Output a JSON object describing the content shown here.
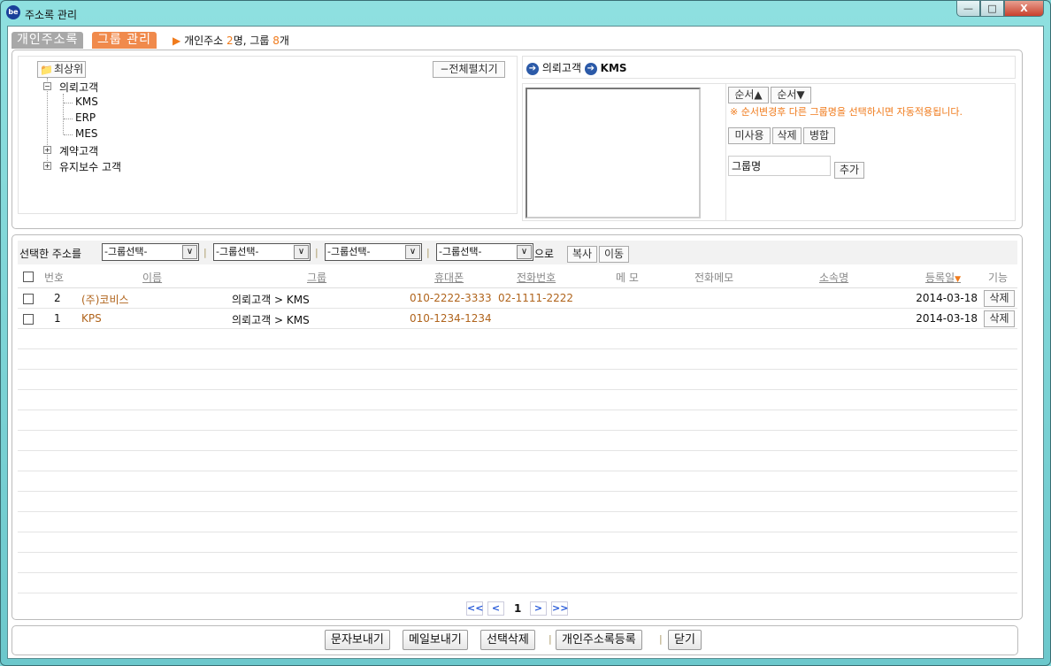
{
  "window": {
    "title": "주소록 관리",
    "min": "—",
    "max": "□",
    "close": "X"
  },
  "tabs": [
    {
      "label": "개인주소록",
      "active": false
    },
    {
      "label": "그룹 관리",
      "active": true
    }
  ],
  "summary": {
    "prefix": "개인주소 ",
    "people": "2",
    "people_unit": "명, 그룹 ",
    "groups": "8",
    "groups_unit": "개"
  },
  "tree": {
    "root_button": "최상위",
    "expand_all": "−전체펼치기",
    "nodes": [
      {
        "label": "의뢰고객",
        "expanded": true,
        "children": [
          "KMS",
          "ERP",
          "MES"
        ]
      },
      {
        "label": "계약고객",
        "expanded": false
      },
      {
        "label": "유지보수 고객",
        "expanded": false
      }
    ]
  },
  "breadcrumb": [
    "의뢰고객",
    "KMS"
  ],
  "group_panel": {
    "order_up": "순서▲",
    "order_down": "순서▼",
    "notice": "※ 순서변경후 다른 그룹명을 선택하시면 자동적용됩니다.",
    "unused": "미사용",
    "delete": "삭제",
    "merge": "병합",
    "group_name_value": "그룹명",
    "add": "추가"
  },
  "toolbar": {
    "label": "선택한 주소를",
    "selects": [
      "-그룹선택-",
      "-그룹선택-",
      "-그룹선택-",
      "-그룹선택-"
    ],
    "suffix": "으로",
    "copy": "복사",
    "move": "이동"
  },
  "table": {
    "headers": {
      "no": "번호",
      "name": "이름",
      "group": "그룹",
      "mobile": "휴대폰",
      "phone": "전화번호",
      "memo": "메 모",
      "phone_memo": "전화메모",
      "company": "소속명",
      "date": "등록일",
      "action": "기능"
    },
    "rows": [
      {
        "no": "2",
        "name": "(주)코비스",
        "group": "의뢰고객 > KMS",
        "mobile": "010-2222-3333",
        "phone": "02-1111-2222",
        "date": "2014-03-18",
        "action": "삭제"
      },
      {
        "no": "1",
        "name": "KPS",
        "group": "의뢰고객 > KMS",
        "mobile": "010-1234-1234",
        "phone": "",
        "date": "2014-03-18",
        "action": "삭제"
      }
    ]
  },
  "pagination": {
    "first": "<<",
    "prev": "<",
    "current": "1",
    "next": ">",
    "last": ">>"
  },
  "footer": {
    "sms": "문자보내기",
    "mail": "메일보내기",
    "delete_selected": "선택삭제",
    "register": "개인주소록등록",
    "close": "닫기"
  },
  "colors": {
    "accent": "#f07b1c",
    "tab_inactive": "#a8a8a8",
    "link": "#b0641c"
  }
}
